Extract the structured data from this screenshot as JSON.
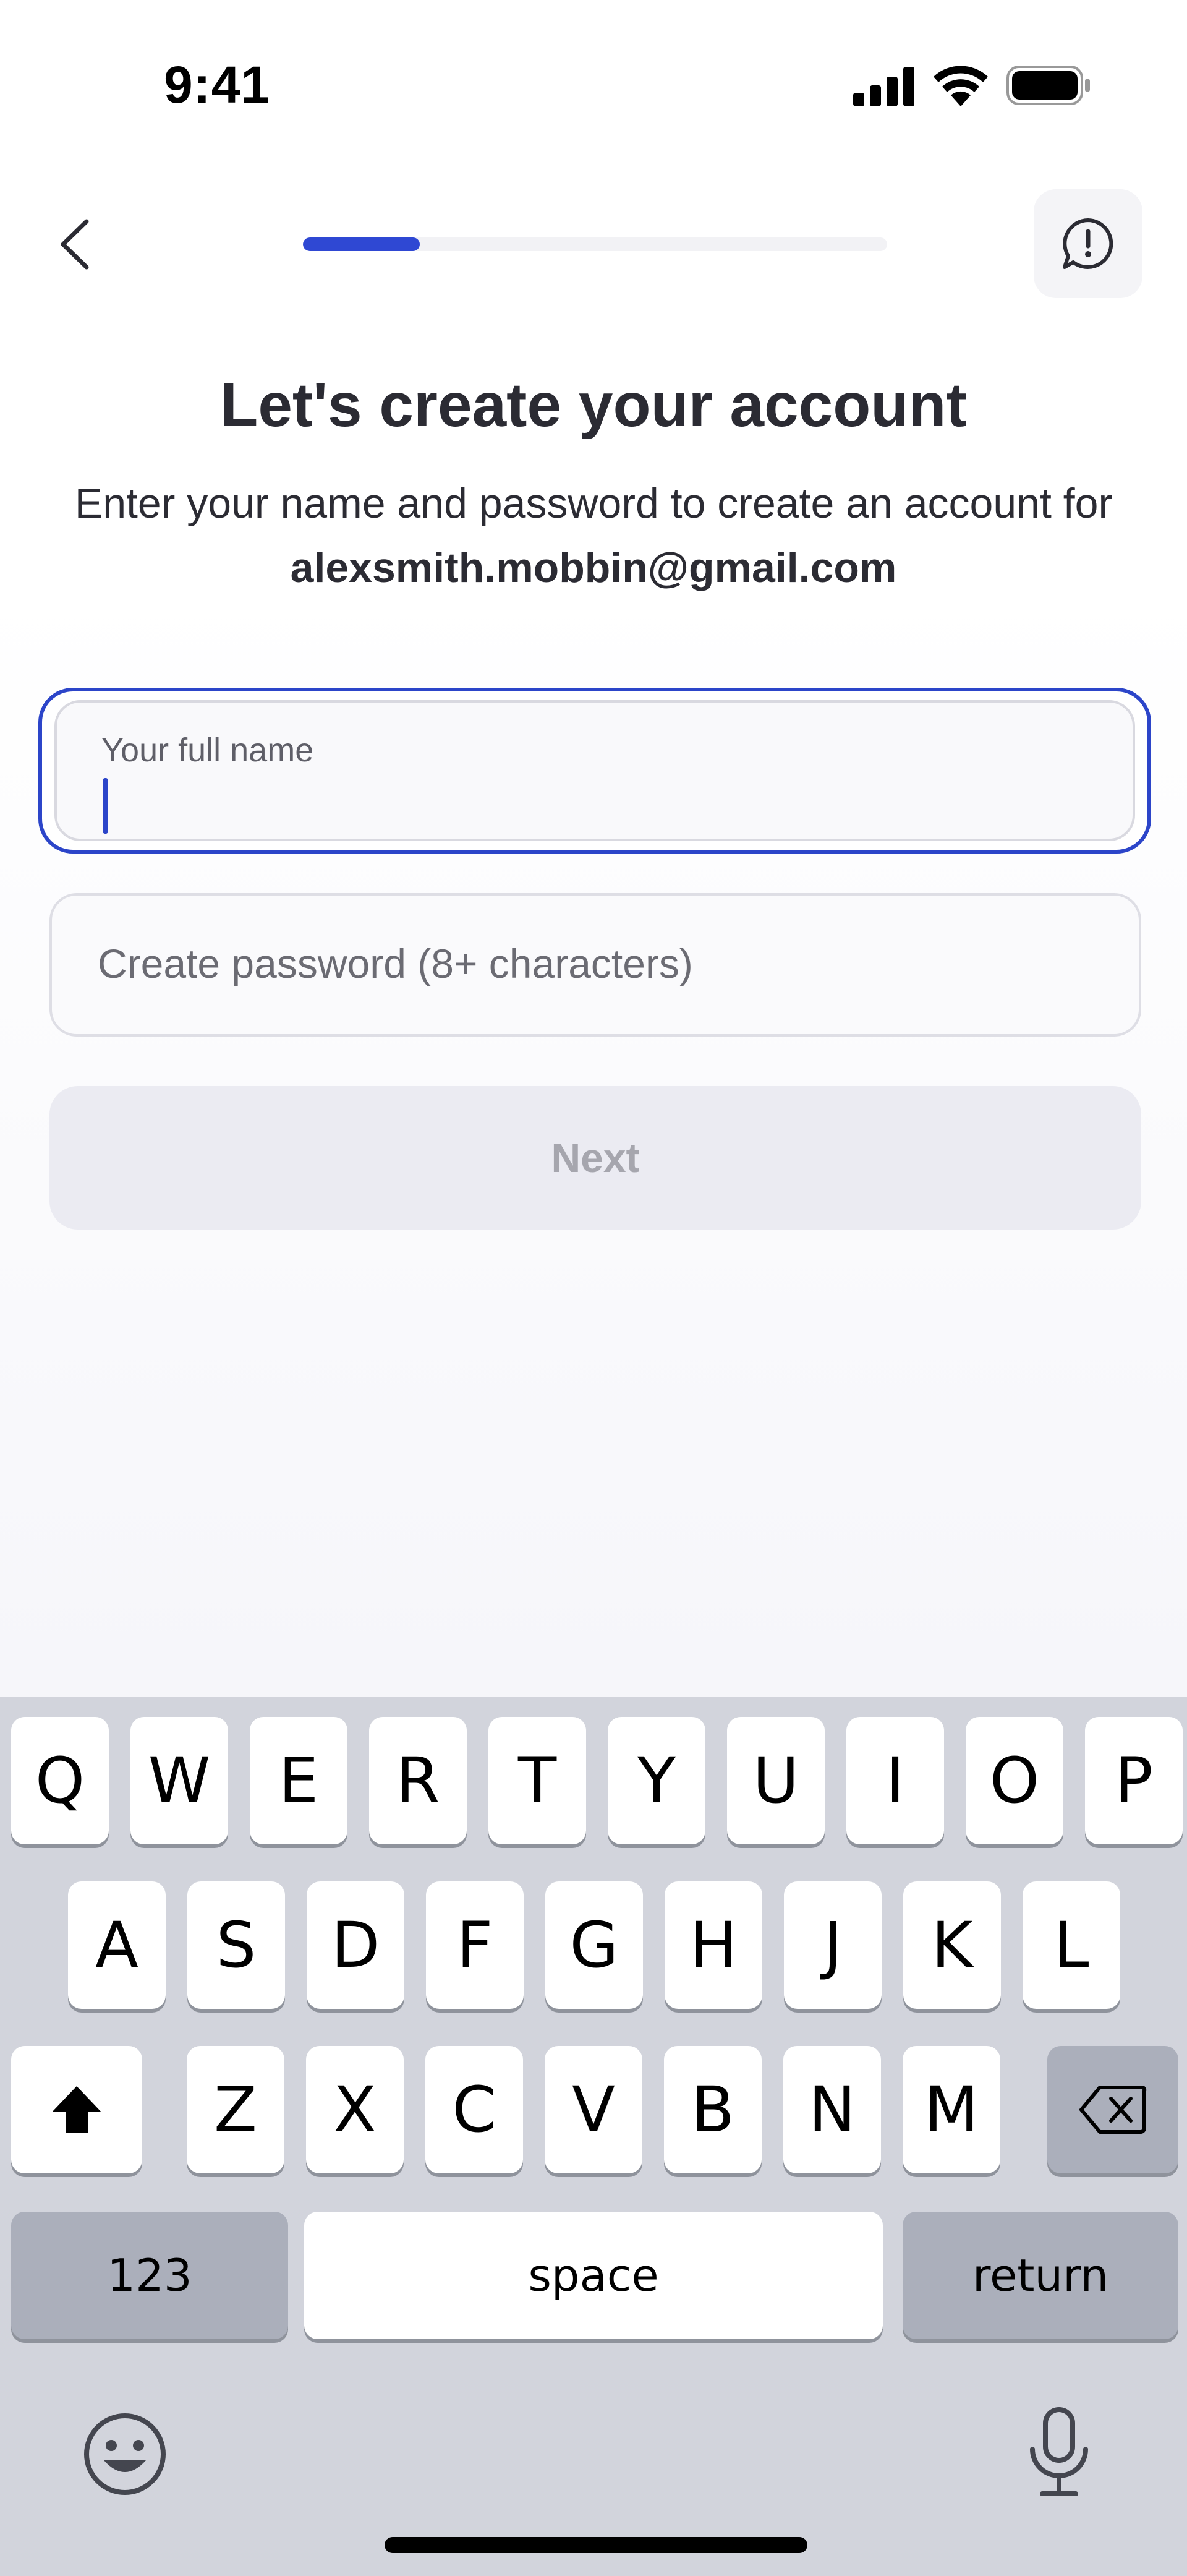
{
  "status_bar": {
    "time": "9:41"
  },
  "onboarding": {
    "progress_fraction": 0.2
  },
  "header": {
    "title": "Let's create your account",
    "subtitle_prefix": "Enter your name and password to create an account for ",
    "email": "alexsmith.mobbin@gmail.com"
  },
  "form": {
    "full_name": {
      "label": "Your full name",
      "value": ""
    },
    "password": {
      "placeholder": "Create password (8+ characters)",
      "value": ""
    },
    "next_label": "Next"
  },
  "keyboard": {
    "row1": [
      "Q",
      "W",
      "E",
      "R",
      "T",
      "Y",
      "U",
      "I",
      "O",
      "P"
    ],
    "row2": [
      "A",
      "S",
      "D",
      "F",
      "G",
      "H",
      "J",
      "K",
      "L"
    ],
    "row3": [
      "Z",
      "X",
      "C",
      "V",
      "B",
      "N",
      "M"
    ],
    "numbers_label": "123",
    "space_label": "space",
    "return_label": "return"
  },
  "icons": {
    "back": "chevron-left-icon",
    "report": "exclamation-bubble-icon",
    "shift": "shift-icon",
    "delete": "delete-backspace-icon",
    "emoji": "emoji-smile-icon",
    "mic": "microphone-icon"
  },
  "colors": {
    "accent": "#2c45c9",
    "title_text": "#2b2b33",
    "disabled_button_bg": "#ebebf2",
    "disabled_button_text": "#a6a6ae",
    "keyboard_bg": "#d2d4dc"
  }
}
